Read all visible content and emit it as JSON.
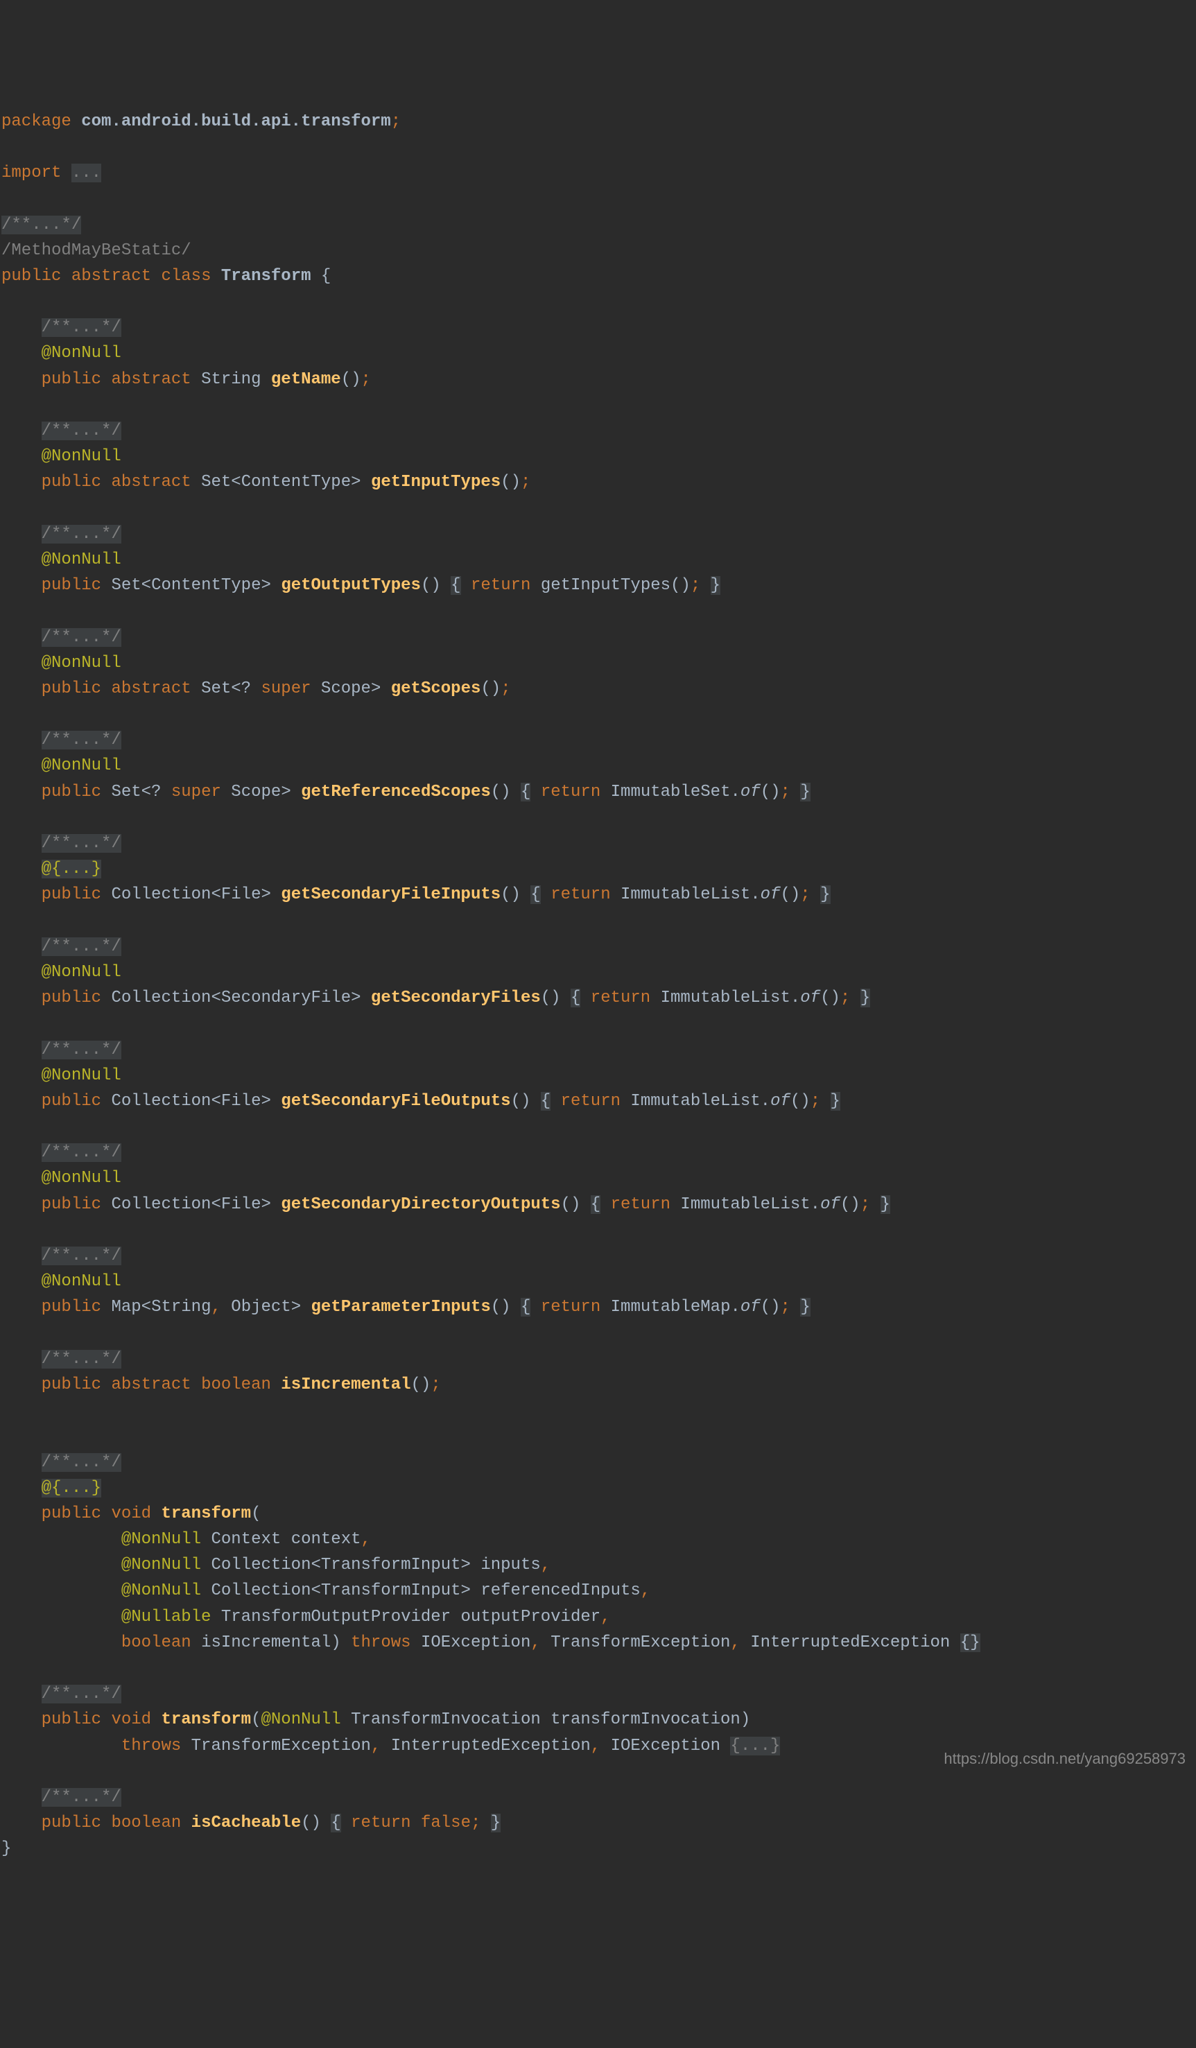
{
  "package_kw": "package",
  "package_name": "com.android.build.api.transform",
  "import_kw": "import",
  "import_dots": "...",
  "comment_folded": "/**...*/",
  "method_may_be_static": "/MethodMayBeStatic/",
  "public_kw": "public",
  "abstract_kw": "abstract",
  "class_kw": "class",
  "void_kw": "void",
  "return_kw": "return",
  "super_kw": "super",
  "throws_kw": "throws",
  "boolean_kw": "boolean",
  "false_kw": "false",
  "class_name": "Transform",
  "ann_nonnull": "@NonNull",
  "ann_nullable": "@Nullable",
  "ann_folded": "@{...}",
  "type_string": "String",
  "type_set": "Set",
  "type_contenttype": "ContentType",
  "type_scope": "Scope",
  "type_collection": "Collection",
  "type_file": "File",
  "type_secondaryfile": "SecondaryFile",
  "type_map": "Map",
  "type_object": "Object",
  "type_context": "Context",
  "type_transforminput": "TransformInput",
  "type_transformoutputprovider": "TransformOutputProvider",
  "type_ioexception": "IOException",
  "type_transformexception": "TransformException",
  "type_interruptedexception": "InterruptedException",
  "type_transforminvocation": "TransformInvocation",
  "type_immutableset": "ImmutableSet",
  "type_immutablelist": "ImmutableList",
  "type_immutablemap": "ImmutableMap",
  "m_getname": "getName",
  "m_getinputtypes": "getInputTypes",
  "m_getoutputtypes": "getOutputTypes",
  "m_getscopes": "getScopes",
  "m_getreferencedscopes": "getReferencedScopes",
  "m_getsecondaryfileinputs": "getSecondaryFileInputs",
  "m_getsecondaryfiles": "getSecondaryFiles",
  "m_getsecondaryfileoutputs": "getSecondaryFileOutputs",
  "m_getsecondarydirectoryoutputs": "getSecondaryDirectoryOutputs",
  "m_getparameterinputs": "getParameterInputs",
  "m_isincremental": "isIncremental",
  "m_transform": "transform",
  "m_iscacheable": "isCacheable",
  "m_of": "of",
  "p_context": "context",
  "p_inputs": "inputs",
  "p_referencedinputs": "referencedInputs",
  "p_outputprovider": "outputProvider",
  "p_isincremental": "isIncremental",
  "p_transforminvocation": "transformInvocation",
  "body_folded": "{...}",
  "watermark": "https://blog.csdn.net/yang69258973"
}
